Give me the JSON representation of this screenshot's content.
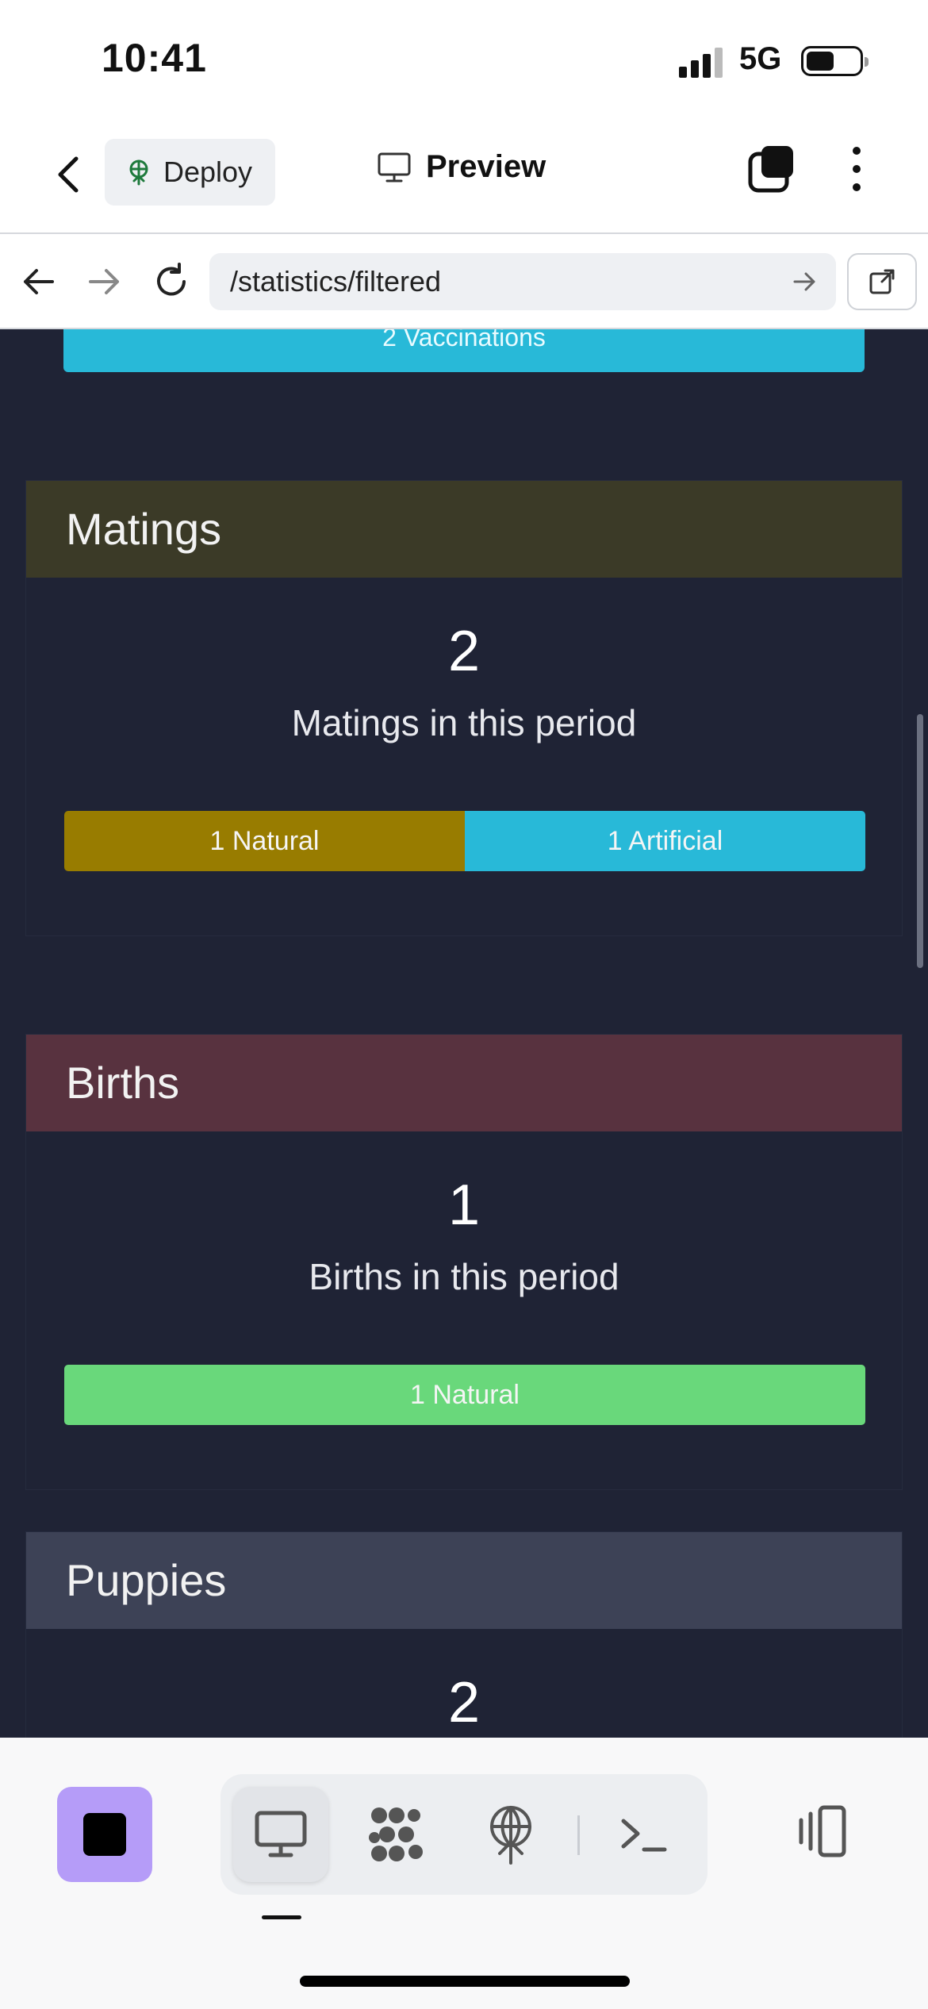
{
  "status_bar": {
    "time": "10:41",
    "network": "5G"
  },
  "header": {
    "deploy_label": "Deploy",
    "title": "Preview"
  },
  "browser": {
    "url": "/statistics/filtered"
  },
  "previous_section": {
    "bar_label": "2 Vaccinations"
  },
  "sections": {
    "matings": {
      "title": "Matings",
      "count": "2",
      "description": "Matings in this period",
      "header_color": "#3b3a27",
      "breakdown": [
        {
          "label": "1 Natural",
          "fraction": 0.5,
          "color": "#987c00"
        },
        {
          "label": "1 Artificial",
          "fraction": 0.5,
          "color": "#28b9d8"
        }
      ]
    },
    "births": {
      "title": "Births",
      "count": "1",
      "description": "Births in this period",
      "header_color": "#58323f",
      "breakdown": [
        {
          "label": "1 Natural",
          "fraction": 1.0,
          "color": "#69d87b"
        }
      ]
    },
    "puppies": {
      "title": "Puppies",
      "count": "2",
      "header_color": "#3d4256"
    }
  },
  "colors": {
    "content_bg": "#1f2335",
    "accent": "#b59cf8"
  },
  "toolbar": {
    "icons": [
      "stop-icon",
      "desktop-icon",
      "molecules-icon",
      "deploy-icon",
      "terminal-icon",
      "panel-toggle-icon"
    ]
  }
}
